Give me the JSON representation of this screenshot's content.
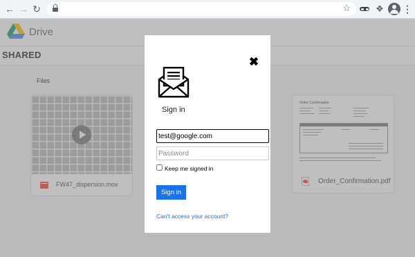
{
  "browser": {
    "back_icon": "arrow-left",
    "forward_icon": "arrow-right",
    "reload_icon": "reload",
    "lock_icon": "lock",
    "bookmark_icon": "star",
    "extensions": [
      "incognito-mask-icon",
      "puzzle-icon",
      "profile-icon",
      "kebab-menu-icon"
    ]
  },
  "app": {
    "title": "Drive",
    "section_title": "SHARED",
    "files_label": "Files",
    "files": [
      {
        "name": "FW47_dispersion.mov",
        "type": "video",
        "icon": "movie-icon"
      },
      {
        "name": "Order_Confirmation.pdf",
        "type": "pdf",
        "icon": "pdf-icon",
        "preview_title": "Order Confirmation"
      }
    ]
  },
  "modal": {
    "icon": "open-envelope-icon",
    "close_icon": "close-x",
    "title": "Sign in",
    "email_value": "test@google.com",
    "password_placeholder": "Password",
    "keep_signed_in_label": "Keep me signed in",
    "keep_signed_in_checked": false,
    "signin_button_label": "Sign in",
    "help_link_label": "Can't access your account?"
  },
  "colors": {
    "primary_blue": "#1a73e8",
    "overlay": "rgba(128,128,128,0.5)",
    "file_icon_red": "#e94235"
  }
}
